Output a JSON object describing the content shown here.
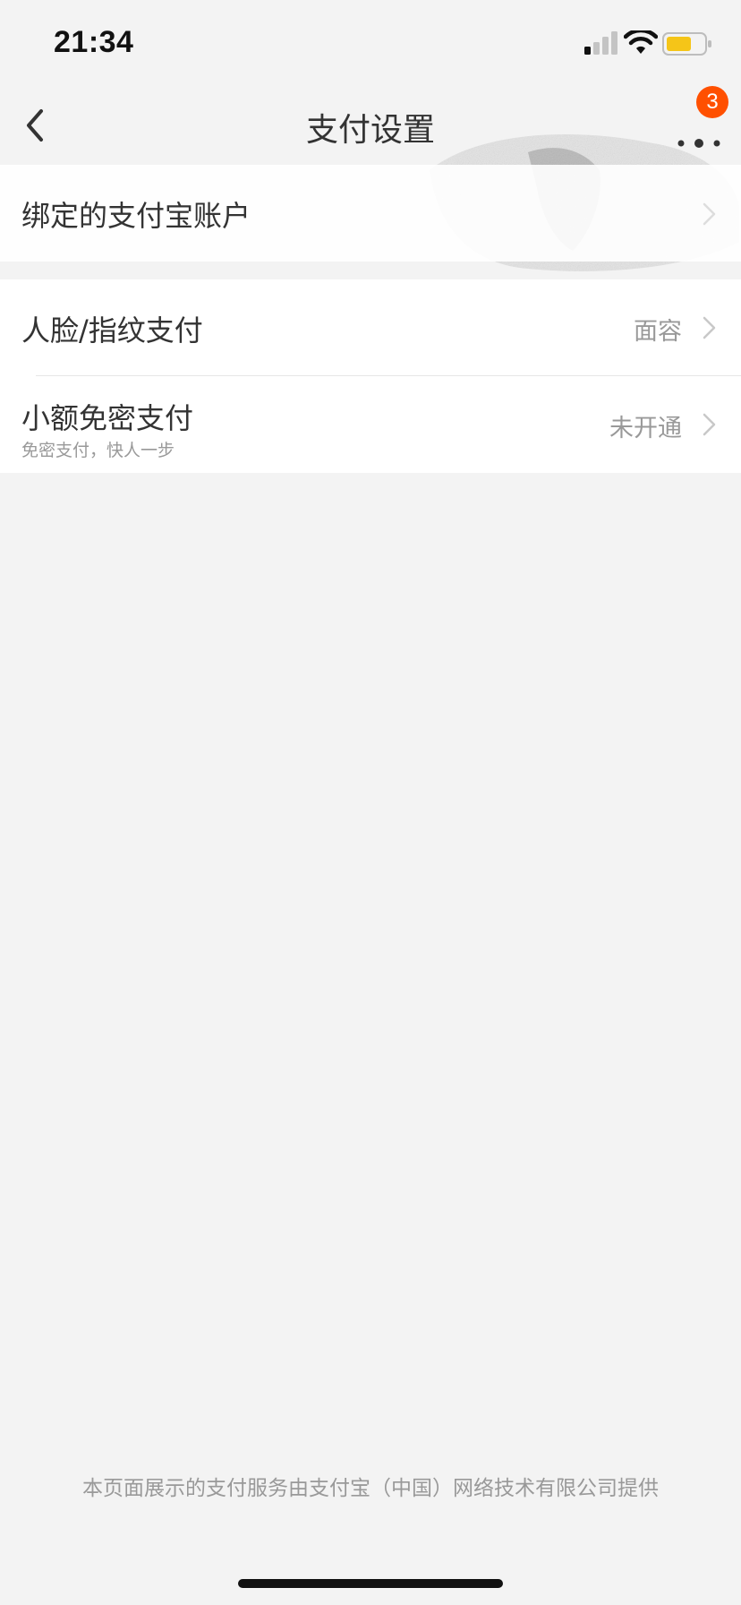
{
  "status_bar": {
    "time": "21:34",
    "battery_color": "#f5c518"
  },
  "nav": {
    "title": "支付设置",
    "badge_count": "3",
    "back_icon": "chevron-left-icon",
    "more_icon": "more-dots-icon"
  },
  "settings": {
    "bound_account": {
      "label": "绑定的支付宝账户"
    },
    "face_fingerprint": {
      "label": "人脸/指纹支付",
      "value": "面容"
    },
    "small_amount": {
      "label": "小额免密支付",
      "sublabel": "免密支付，快人一步",
      "value": "未开通"
    }
  },
  "footer": {
    "note": "本页面展示的支付服务由支付宝（中国）网络技术有限公司提供"
  },
  "colors": {
    "accent_badge": "#ff5000",
    "background": "#f3f3f3",
    "text_primary": "#333333",
    "text_secondary": "#999999"
  }
}
